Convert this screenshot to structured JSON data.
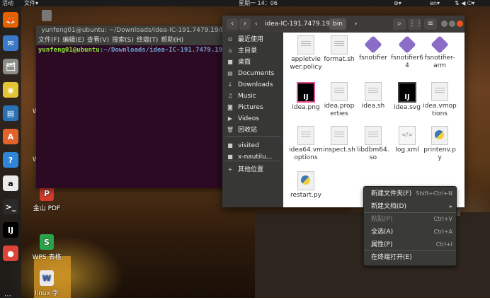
{
  "topbar": {
    "activities": "活动",
    "app_menu": "文件▾",
    "clock": "星期一 14：06",
    "lang": "en▾"
  },
  "dock": {
    "items": [
      {
        "icon": "firefox-icon",
        "color": "#e66000",
        "glyph": "🦊"
      },
      {
        "icon": "thunderbird-icon",
        "color": "#3a78c9",
        "glyph": "✉"
      },
      {
        "icon": "files-icon",
        "color": "#8c8c88",
        "glyph": "🗂"
      },
      {
        "icon": "rhythmbox-icon",
        "color": "#e3c436",
        "glyph": "◉"
      },
      {
        "icon": "writer-icon",
        "color": "#2a72b5",
        "glyph": "▤"
      },
      {
        "icon": "software-center-icon",
        "color": "#e2642c",
        "glyph": "A"
      },
      {
        "icon": "help-icon",
        "color": "#2f86d8",
        "glyph": "?"
      },
      {
        "icon": "amazon-icon",
        "color": "#eaeaea",
        "glyph": "a"
      },
      {
        "icon": "terminal-icon",
        "color": "#2a2a2a",
        "glyph": ">_"
      },
      {
        "icon": "intellij-icon",
        "color": "#000000",
        "glyph": "IJ"
      },
      {
        "icon": "chrome-icon",
        "color": "#db4437",
        "glyph": "●"
      }
    ]
  },
  "desktop": {
    "wps_pdf_label": "金山 PDF",
    "wps_sheet_label": "WPS 表格",
    "doc_label": "linux 学",
    "side_w1": "W",
    "side_w2": "W"
  },
  "terminal": {
    "title": "yunfeng01@ubuntu: ~/Downloads/idea-IC-191.7479.19/bin",
    "menu": [
      "文件(F)",
      "编辑(E)",
      "查看(V)",
      "搜索(S)",
      "终端(T)",
      "帮助(H)"
    ],
    "prompt_user": "yunfeng01@ubuntu",
    "prompt_path": ":~/Downloads/idea-IC-191.7479.19/bin$"
  },
  "filemanager": {
    "crumbs": [
      "idea-IC-191.7479.19",
      "bin"
    ],
    "sidebar": [
      {
        "label": "最近使用",
        "icon": "clock-icon",
        "glyph": "⊙"
      },
      {
        "label": "主目录",
        "icon": "home-icon",
        "glyph": "⌂"
      },
      {
        "label": "桌面",
        "icon": "desktop-folder-icon",
        "glyph": "■"
      },
      {
        "label": "Documents",
        "icon": "documents-icon",
        "glyph": "▤"
      },
      {
        "label": "Downloads",
        "icon": "downloads-icon",
        "glyph": "↓"
      },
      {
        "label": "Music",
        "icon": "music-icon",
        "glyph": "♫"
      },
      {
        "label": "Pictures",
        "icon": "pictures-icon",
        "glyph": "◙"
      },
      {
        "label": "Videos",
        "icon": "videos-icon",
        "glyph": "▶"
      },
      {
        "label": "回收站",
        "icon": "trash-icon",
        "glyph": "🗑"
      },
      {
        "label": "visited",
        "icon": "folder-icon",
        "glyph": "■"
      },
      {
        "label": "x-nautilu...",
        "icon": "folder-icon",
        "glyph": "■"
      },
      {
        "label": "其他位置",
        "icon": "plus-icon",
        "glyph": "+"
      }
    ],
    "files": [
      {
        "name": "appletviewer.policy",
        "kind": "doc"
      },
      {
        "name": "format.sh",
        "kind": "doc"
      },
      {
        "name": "fsnotifier",
        "kind": "diam"
      },
      {
        "name": "fsnotifier64",
        "kind": "diam"
      },
      {
        "name": "fsnotifier-arm",
        "kind": "diam"
      },
      {
        "name": "idea.png",
        "kind": "ij"
      },
      {
        "name": "idea.properties",
        "kind": "doc"
      },
      {
        "name": "idea.sh",
        "kind": "doc"
      },
      {
        "name": "idea.svg",
        "kind": "ijplain"
      },
      {
        "name": "idea.vmoptions",
        "kind": "doc"
      },
      {
        "name": "idea64.vmoptions",
        "kind": "doc"
      },
      {
        "name": "inspect.sh",
        "kind": "doc"
      },
      {
        "name": "libdbm64.so",
        "kind": "doc"
      },
      {
        "name": "log.xml",
        "kind": "xml"
      },
      {
        "name": "printenv.py",
        "kind": "py"
      },
      {
        "name": "restart.py",
        "kind": "py"
      }
    ]
  },
  "context_menu": {
    "items": [
      {
        "label": "新建文件夹(F)",
        "shortcut": "Shift+Ctrl+N",
        "disabled": false
      },
      {
        "label": "新建文档(D)",
        "shortcut": "▸",
        "disabled": false
      },
      {
        "label": "粘贴(P)",
        "shortcut": "Ctrl+V",
        "disabled": true
      },
      {
        "label": "全选(A)",
        "shortcut": "Ctrl+A",
        "disabled": false
      },
      {
        "label": "属性(P)",
        "shortcut": "Ctrl+I",
        "disabled": false
      },
      {
        "label": "在终端打开(E)",
        "shortcut": "",
        "disabled": false
      }
    ]
  }
}
